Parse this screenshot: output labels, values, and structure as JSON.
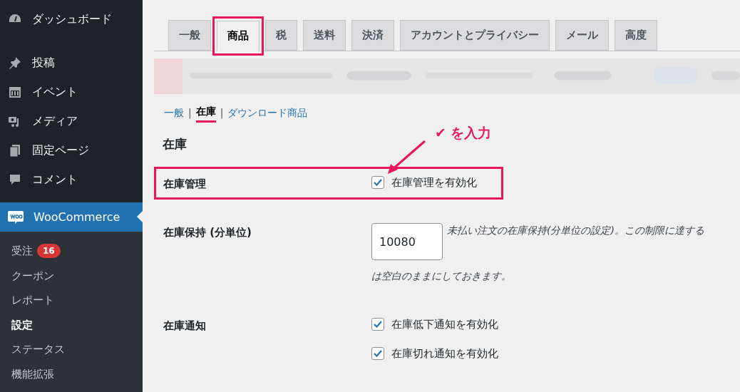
{
  "sidebar": {
    "items": [
      {
        "label": "ダッシュボード",
        "selected": false
      },
      {
        "label": "投稿",
        "selected": false
      },
      {
        "label": "イベント",
        "selected": false
      },
      {
        "label": "メディア",
        "selected": false
      },
      {
        "label": "固定ページ",
        "selected": false
      },
      {
        "label": "コメント",
        "selected": false
      },
      {
        "label": "WooCommerce",
        "selected": true
      }
    ],
    "submenu": [
      {
        "label": "受注",
        "badge": "16",
        "selected": false
      },
      {
        "label": "クーポン",
        "selected": false
      },
      {
        "label": "レポート",
        "selected": false
      },
      {
        "label": "設定",
        "selected": true
      },
      {
        "label": "ステータス",
        "selected": false
      },
      {
        "label": "機能拡張",
        "selected": false
      }
    ]
  },
  "tabs": [
    {
      "label": "一般",
      "selected": false,
      "highlighted": false
    },
    {
      "label": "商品",
      "selected": true,
      "highlighted": true
    },
    {
      "label": "税",
      "selected": false,
      "highlighted": false
    },
    {
      "label": "送料",
      "selected": false,
      "highlighted": false
    },
    {
      "label": "決済",
      "selected": false,
      "highlighted": false
    },
    {
      "label": "アカウントとプライバシー",
      "selected": false,
      "highlighted": false
    },
    {
      "label": "メール",
      "selected": false,
      "highlighted": false
    },
    {
      "label": "高度",
      "selected": false,
      "highlighted": false
    }
  ],
  "subnav": [
    {
      "label": "一般",
      "selected": false,
      "underlined": false
    },
    {
      "kind": "separator",
      "label": "|"
    },
    {
      "label": "在庫",
      "selected": true,
      "underlined": true
    },
    {
      "kind": "separator",
      "label": "|"
    },
    {
      "label": "ダウンロード商品",
      "selected": false,
      "underlined": false
    }
  ],
  "section_title": "在庫",
  "callout": {
    "mark": "✔",
    "text": "を入力"
  },
  "rows": [
    {
      "kind": "checkboxes",
      "label": "在庫管理",
      "highlighted": true,
      "options": [
        {
          "label": "在庫管理を有効化",
          "checked": true
        }
      ]
    },
    {
      "kind": "number",
      "label": "在庫保持 (分単位)",
      "highlighted": false,
      "value": "10080",
      "description_lines": [
        "未払い注文の在庫保持(分単位の設定)。この制限に達する",
        "は空白のままにしておきます。"
      ]
    },
    {
      "kind": "checkboxes",
      "label": "在庫通知",
      "highlighted": false,
      "options": [
        {
          "label": "在庫低下通知を有効化",
          "checked": true
        },
        {
          "label": "在庫切れ通知を有効化",
          "checked": true
        }
      ]
    }
  ]
}
